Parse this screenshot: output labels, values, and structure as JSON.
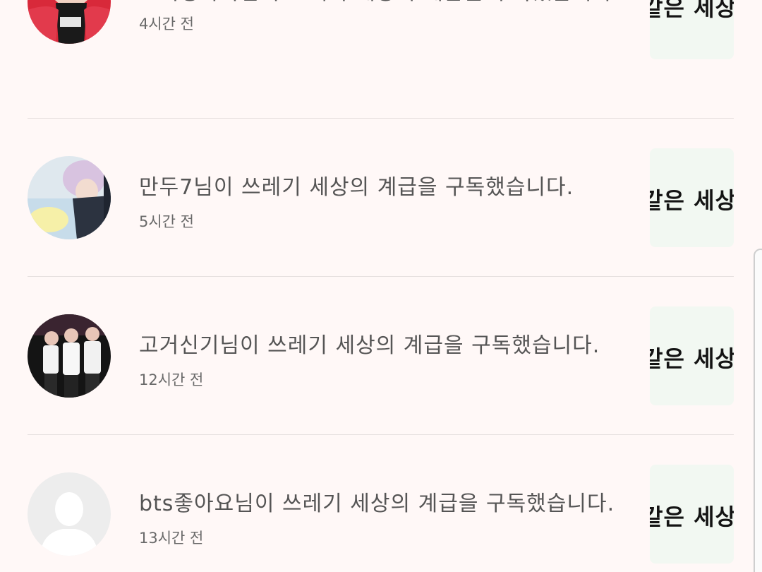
{
  "notifications": [
    {
      "avatar": "user-photo-red-jacket",
      "message": "모찌밍자까님이 쓰레기 세상의 계급을 구독했습니다.",
      "time": "4시간 전",
      "thumbnail_text": "같은 세상"
    },
    {
      "avatar": "user-photo-lavender-hair",
      "message": "만두7님이 쓰레기 세상의 계급을 구독했습니다.",
      "time": "5시간 전",
      "thumbnail_text": "같은 세상"
    },
    {
      "avatar": "user-photo-group-stage",
      "message": "고거신기님이 쓰레기 세상의 계급을 구독했습니다.",
      "time": "12시간 전",
      "thumbnail_text": "같은 세상"
    },
    {
      "avatar": "default-user-icon",
      "message": "bts좋아요님이 쓰레기 세상의 계급을 구독했습니다.",
      "time": "13시간 전",
      "thumbnail_text": "같은 세상"
    }
  ]
}
